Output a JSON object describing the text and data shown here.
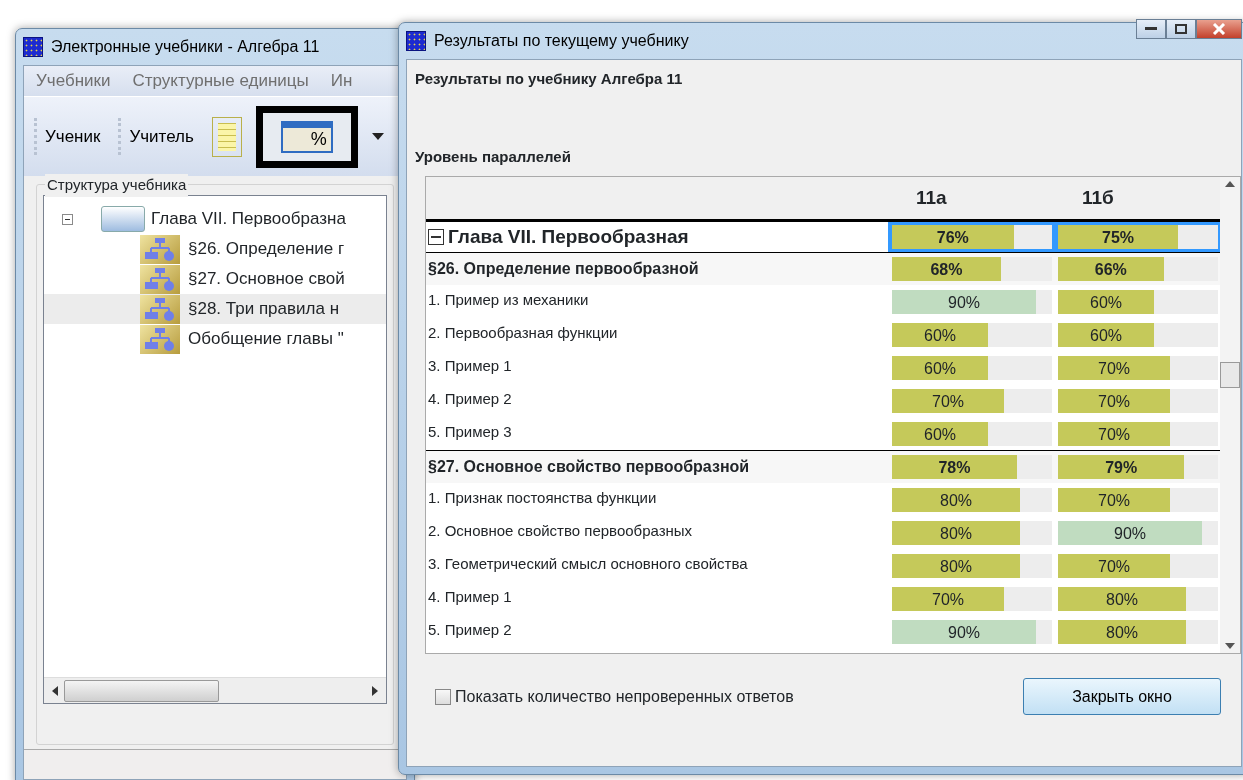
{
  "main_window": {
    "title": "Электронные учебники - Алгебра 11",
    "menu": [
      "Учебники",
      "Структурные единицы",
      "Ин"
    ],
    "toolbar": [
      {
        "kind": "text",
        "label": "Ученик"
      },
      {
        "kind": "text",
        "label": "Учитель"
      },
      {
        "kind": "notes",
        "highlighted": false
      },
      {
        "kind": "percent",
        "label": "%",
        "highlighted": true
      }
    ],
    "tree": {
      "title": "Структура учебника",
      "items": [
        {
          "label": "Глава VII. Первообразна",
          "expanded": true,
          "selected": false,
          "children": [
            {
              "label": "§26. Определение г",
              "selected": false
            },
            {
              "label": "§27. Основное свой",
              "selected": false
            },
            {
              "label": "§28. Три правила н",
              "selected": true
            },
            {
              "label": "Обобщение главы \"",
              "selected": false
            }
          ]
        }
      ]
    }
  },
  "dialog": {
    "title": "Результаты по текущему учебнику",
    "heading": "Результаты по учебнику Алгебра 11",
    "subheading": "Уровень параллелей",
    "columns": [
      "11а",
      "11б"
    ],
    "rows": [
      {
        "kind": "chapter",
        "label": "Глава VII. Первообразная",
        "expanded": true,
        "selected": true,
        "cells": [
          {
            "text": "76%",
            "level": 0.76,
            "color": "#c5c95a"
          },
          {
            "text": "75%",
            "level": 0.75,
            "color": "#c5c95a"
          }
        ]
      },
      {
        "kind": "section",
        "label": "§26. Определение первообразной",
        "selected": false,
        "cells": [
          {
            "text": "68%",
            "level": 0.68,
            "color": "#c5c95a"
          },
          {
            "text": "66%",
            "level": 0.66,
            "color": "#c5c95a"
          }
        ]
      },
      {
        "kind": "item",
        "label": "1. Пример из механики",
        "selected": false,
        "cells": [
          {
            "text": "90%",
            "level": 0.9,
            "color": "#c0dcc0"
          },
          {
            "text": "60%",
            "level": 0.6,
            "color": "#c5c95a"
          }
        ]
      },
      {
        "kind": "item",
        "label": "2. Первообразная функции",
        "selected": false,
        "cells": [
          {
            "text": "60%",
            "level": 0.6,
            "color": "#c5c95a"
          },
          {
            "text": "60%",
            "level": 0.6,
            "color": "#c5c95a"
          }
        ]
      },
      {
        "kind": "item",
        "label": "3. Пример 1",
        "selected": false,
        "cells": [
          {
            "text": "60%",
            "level": 0.6,
            "color": "#c5c95a"
          },
          {
            "text": "70%",
            "level": 0.7,
            "color": "#c5c95a"
          }
        ]
      },
      {
        "kind": "item",
        "label": "4. Пример 2",
        "selected": false,
        "cells": [
          {
            "text": "70%",
            "level": 0.7,
            "color": "#c5c95a"
          },
          {
            "text": "70%",
            "level": 0.7,
            "color": "#c5c95a"
          }
        ]
      },
      {
        "kind": "item",
        "label": "5. Пример 3",
        "selected": false,
        "cells": [
          {
            "text": "60%",
            "level": 0.6,
            "color": "#c5c95a"
          },
          {
            "text": "70%",
            "level": 0.7,
            "color": "#c5c95a"
          }
        ]
      },
      {
        "kind": "section",
        "label": "§27. Основное свойство первообразной",
        "selected": false,
        "cells": [
          {
            "text": "78%",
            "level": 0.78,
            "color": "#c5c95a"
          },
          {
            "text": "79%",
            "level": 0.79,
            "color": "#c5c95a"
          }
        ]
      },
      {
        "kind": "item",
        "label": "1. Признак постоянства функции",
        "selected": false,
        "cells": [
          {
            "text": "80%",
            "level": 0.8,
            "color": "#c5c95a"
          },
          {
            "text": "70%",
            "level": 0.7,
            "color": "#c5c95a"
          }
        ]
      },
      {
        "kind": "item",
        "label": "2. Основное свойство первообразных",
        "selected": false,
        "cells": [
          {
            "text": "80%",
            "level": 0.8,
            "color": "#c5c95a"
          },
          {
            "text": "90%",
            "level": 0.9,
            "color": "#c0dcc0"
          }
        ]
      },
      {
        "kind": "item",
        "label": "3. Геометрический смысл основного свойства",
        "selected": false,
        "cells": [
          {
            "text": "80%",
            "level": 0.8,
            "color": "#c5c95a"
          },
          {
            "text": "70%",
            "level": 0.7,
            "color": "#c5c95a"
          }
        ]
      },
      {
        "kind": "item",
        "label": "4. Пример 1",
        "selected": false,
        "cells": [
          {
            "text": "70%",
            "level": 0.7,
            "color": "#c5c95a"
          },
          {
            "text": "80%",
            "level": 0.8,
            "color": "#c5c95a"
          }
        ]
      },
      {
        "kind": "item",
        "label": "5. Пример 2",
        "selected": false,
        "cells": [
          {
            "text": "90%",
            "level": 0.9,
            "color": "#c0dcc0"
          },
          {
            "text": "80%",
            "level": 0.8,
            "color": "#c5c95a"
          }
        ]
      }
    ],
    "checkbox": {
      "label": "Показать количество непроверенных ответов",
      "checked": false
    },
    "close_button": "Закрыть окно"
  }
}
